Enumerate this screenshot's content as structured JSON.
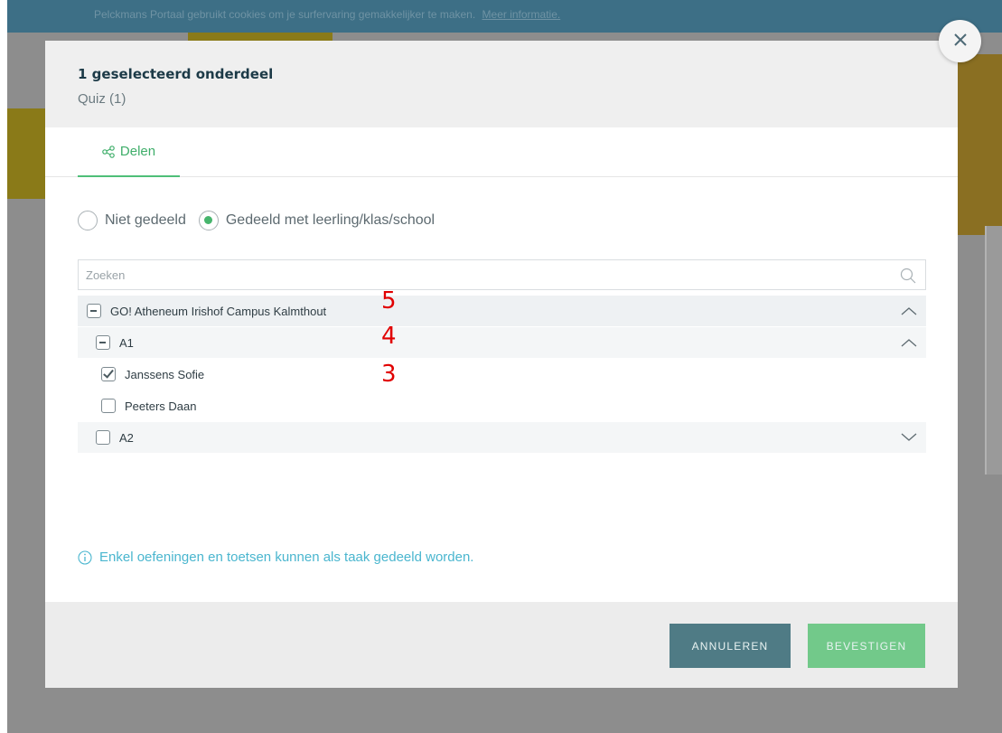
{
  "cookie_bar": {
    "text": "Pelckmans Portaal gebruikt cookies om je surfervaring gemakkelijker te maken.",
    "link": "Meer informatie."
  },
  "modal": {
    "title": "1 geselecteerd onderdeel",
    "subtitle": "Quiz (1)",
    "tab": {
      "label": "Delen",
      "icon": "share-icon"
    },
    "radios": [
      {
        "label": "Niet gedeeld",
        "checked": false
      },
      {
        "label": "Gedeeld met leerling/klas/school",
        "checked": true
      }
    ],
    "search": {
      "placeholder": "Zoeken",
      "value": ""
    },
    "tree": [
      {
        "label": "GO! Atheneum Irishof Campus Kalmthout",
        "state": "partial",
        "expanded": true,
        "badge": "5"
      },
      {
        "label": "A1",
        "state": "partial",
        "expanded": true,
        "badge": "4"
      },
      {
        "label": "Janssens Sofie",
        "state": "checked",
        "badge": "3"
      },
      {
        "label": "Peeters Daan",
        "state": "unchecked"
      },
      {
        "label": "A2",
        "state": "unchecked",
        "expanded": false
      }
    ],
    "info_text": "Enkel oefeningen en toetsen kunnen als taak gedeeld worden.",
    "buttons": {
      "cancel": "ANNULEREN",
      "confirm": "BEVESTIGEN"
    }
  },
  "colors": {
    "accent_green": "#47b56d",
    "info_blue": "#4ab6cf",
    "cancel_button": "#4f7b85",
    "confirm_button": "#72c98a",
    "badge_red": "#e10000"
  }
}
